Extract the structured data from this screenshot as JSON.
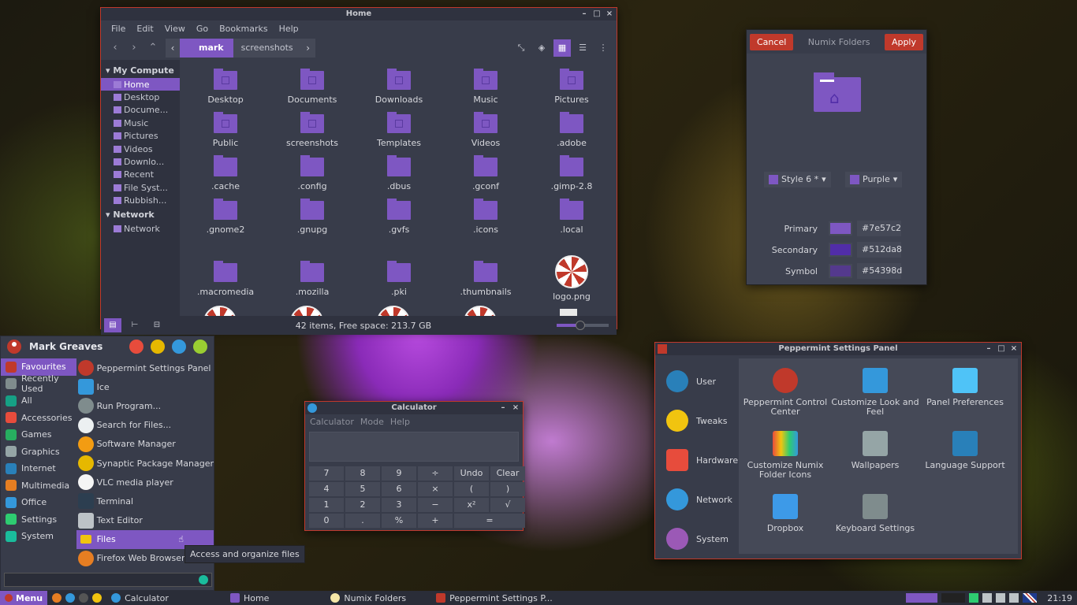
{
  "filemanager": {
    "title": "Home",
    "menu": [
      "File",
      "Edit",
      "View",
      "Go",
      "Bookmarks",
      "Help"
    ],
    "crumbs": [
      "mark",
      "screenshots"
    ],
    "sidebar": {
      "heading_computer": "My Compute",
      "items": [
        "Home",
        "Desktop",
        "Docume...",
        "Music",
        "Pictures",
        "Videos",
        "Downlo...",
        "Recent",
        "File Syst...",
        "Rubbish..."
      ],
      "heading_network": "Network",
      "network_items": [
        "Network"
      ]
    },
    "files": [
      "Desktop",
      "Documents",
      "Downloads",
      "Music",
      "Pictures",
      "Public",
      "screenshots",
      "Templates",
      "Videos",
      ".adobe",
      ".cache",
      ".config",
      ".dbus",
      ".gconf",
      ".gimp-2.8",
      ".gnome2",
      ".gnupg",
      ".gvfs",
      ".icons",
      ".local",
      ".macromedia",
      ".mozilla",
      ".pki",
      ".thumbnails",
      "logo.png"
    ],
    "status": "42 items, Free space: 213.7 GB",
    "zoom_fraction": 0.45
  },
  "numix": {
    "cancel": "Cancel",
    "title": "Numix Folders",
    "apply": "Apply",
    "style": "Style 6 *",
    "color_theme": "Purple",
    "rows": [
      {
        "label": "Primary",
        "hex": "#7e57c2"
      },
      {
        "label": "Secondary",
        "hex": "#512da8"
      },
      {
        "label": "Symbol",
        "hex": "#54398d"
      }
    ]
  },
  "menu": {
    "user": "Mark Greaves",
    "categories": [
      "Favourites",
      "Recently Used",
      "All",
      "Accessories",
      "Games",
      "Graphics",
      "Internet",
      "Multimedia",
      "Office",
      "Settings",
      "System"
    ],
    "apps": [
      "Peppermint Settings Panel",
      "Ice",
      "Run Program...",
      "Search for Files...",
      "Software Manager",
      "Synaptic Package Manager",
      "VLC media player",
      "Terminal",
      "Text Editor",
      "Files",
      "Firefox Web Browser"
    ],
    "tooltip": "Access and organize files"
  },
  "calculator": {
    "title": "Calculator",
    "menu": [
      "Calculator",
      "Mode",
      "Help"
    ],
    "buttons": [
      "7",
      "8",
      "9",
      "÷",
      "Undo",
      "Clear",
      "4",
      "5",
      "6",
      "×",
      "(",
      ")",
      "1",
      "2",
      "3",
      "−",
      "x²",
      "√",
      "0",
      ".",
      "%",
      "+",
      "="
    ]
  },
  "settings": {
    "title": "Peppermint Settings Panel",
    "categories": [
      "User",
      "Tweaks",
      "Hardware",
      "Network",
      "System"
    ],
    "items": [
      "Peppermint Control Center",
      "Customize Look and Feel",
      "Panel Preferences",
      "Customize Numix Folder Icons",
      "Wallpapers",
      "Language Support",
      "Dropbox",
      "Keyboard Settings"
    ]
  },
  "taskbar": {
    "menu": "Menu",
    "tasks": [
      "Calculator",
      "Home",
      "Numix Folders",
      "Peppermint Settings P..."
    ],
    "clock": "21:19"
  },
  "colors": {
    "accent": "#7e57c2",
    "accent_dark": "#512da8",
    "symbol": "#54398d",
    "danger": "#c0392b"
  }
}
